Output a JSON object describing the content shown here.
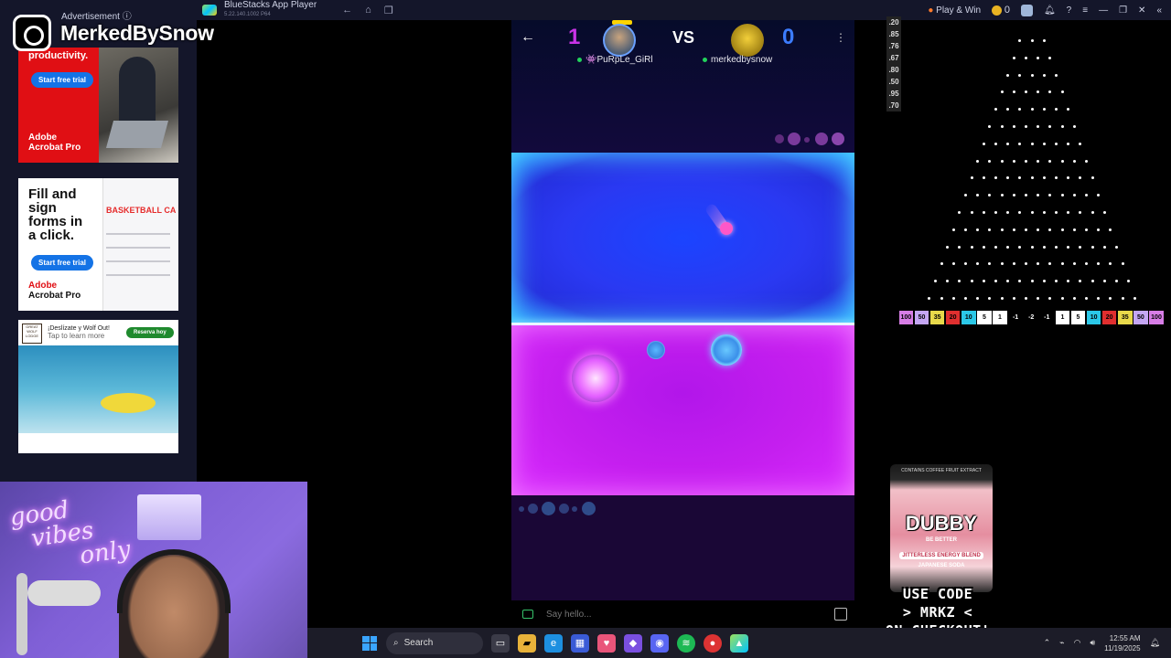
{
  "titlebar": {
    "app_title": "BlueStacks App Player",
    "version": "5.22.140.1002 P64",
    "play_win": "Play & Win",
    "coins": "0"
  },
  "overlay": {
    "ad_label": "Advertisement ⓘ",
    "brand_name": "MerkedBySnow"
  },
  "ads": {
    "ad1": {
      "headline": "productivity.",
      "button": "Start free trial",
      "brand_line1": "Adobe",
      "brand_line2": "Acrobat Pro"
    },
    "ad2": {
      "headline_lines": [
        "Fill and",
        "sign",
        "forms in",
        "a click."
      ],
      "button": "Start free trial",
      "doc_title": "BASKETBALL CA",
      "brand_line1": "Adobe",
      "brand_line2": "Acrobat Pro"
    },
    "ad3": {
      "line1": "¡Deslízate y Wolf Out!",
      "line2": "Tap to learn more",
      "button": "Reserva hoy",
      "logo_text": "GREAT WOLF LODGE"
    }
  },
  "game": {
    "player1": {
      "name": "👾PuRpLe_GiRl",
      "score": "1"
    },
    "player2": {
      "name": "merkedbysnow",
      "score": "0"
    },
    "vs_label": "VS",
    "chat_placeholder": "Say hello..."
  },
  "plinko": {
    "odds": [
      ".20",
      ".85",
      ".76",
      ".67",
      ".80",
      ".50",
      ".95",
      ".70"
    ],
    "slots": [
      "100",
      "50",
      "35",
      "20",
      "10",
      "5",
      "1",
      "-1",
      "-2",
      "-1",
      "1",
      "5",
      "10",
      "20",
      "35",
      "50",
      "100"
    ],
    "slot_colors": [
      "#d77de6",
      "#c4a6f4",
      "#e8d94a",
      "#e02f2f",
      "#2bc8e8",
      "#ffffff",
      "#ffffff",
      "#000000",
      "#000000",
      "#000000",
      "#ffffff",
      "#ffffff",
      "#2bc8e8",
      "#e02f2f",
      "#e8d94a",
      "#c4a6f4",
      "#d77de6"
    ],
    "rows": 16
  },
  "product": {
    "top_text": "CONTAINS COFFEE FRUIT EXTRACT",
    "brand": "DUBBY",
    "tagline": "BE BETTER",
    "blend": "JITTERLESS ENERGY BLEND",
    "flavor": "JAPANESE SODA",
    "promo_lines": [
      "USE CODE",
      "> MRKZ <",
      "ON CHECKOUT!"
    ]
  },
  "webcam": {
    "neon_lines": [
      "good",
      "vibes",
      "only"
    ]
  },
  "taskbar": {
    "search_label": "Search",
    "time": "12:55 AM",
    "date": "11/19/2025"
  },
  "colors": {
    "field_top": "#2a39f2",
    "field_bottom": "#c51fef",
    "accent_green": "#22d35b"
  }
}
